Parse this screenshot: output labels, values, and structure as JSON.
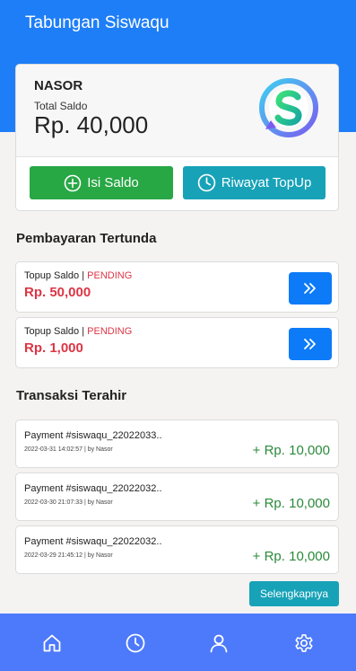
{
  "header": {
    "title": "Tabungan Siswaqu"
  },
  "account": {
    "name": "NASOR",
    "saldo_label": "Total Saldo",
    "saldo_value": "Rp. 40,000",
    "topup_button": "Isi Saldo",
    "history_button": "Riwayat TopUp"
  },
  "pending": {
    "title": "Pembayaran Tertunda",
    "items": [
      {
        "label": "Topup Saldo",
        "separator": "|",
        "status": "PENDING",
        "amount": "Rp. 50,000"
      },
      {
        "label": "Topup Saldo",
        "separator": "|",
        "status": "PENDING",
        "amount": "Rp. 1,000"
      }
    ]
  },
  "transactions": {
    "title": "Transaksi Terahir",
    "items": [
      {
        "title": "Payment #siswaqu_22022033..",
        "meta": "2022-03-31 14:02:57 | by Nasor",
        "amount": "+ Rp. 10,000"
      },
      {
        "title": "Payment #siswaqu_22022032..",
        "meta": "2022-03-30 21:07:33 | by Nasor",
        "amount": "+ Rp. 10,000"
      },
      {
        "title": "Payment #siswaqu_22022032..",
        "meta": "2022-03-29 21:45:12 | by Nasor",
        "amount": "+ Rp. 10,000"
      }
    ],
    "more_button": "Selengkapnya"
  },
  "nav": {
    "items": [
      {
        "icon": "home-icon"
      },
      {
        "icon": "clock-icon"
      },
      {
        "icon": "user-icon"
      },
      {
        "icon": "gear-icon"
      }
    ]
  },
  "colors": {
    "primary": "#1e7ef7",
    "nav": "#4d79fb",
    "success": "#28a745",
    "info": "#17a2b8",
    "danger": "#dc3545",
    "amount": "#2a8a3a"
  }
}
